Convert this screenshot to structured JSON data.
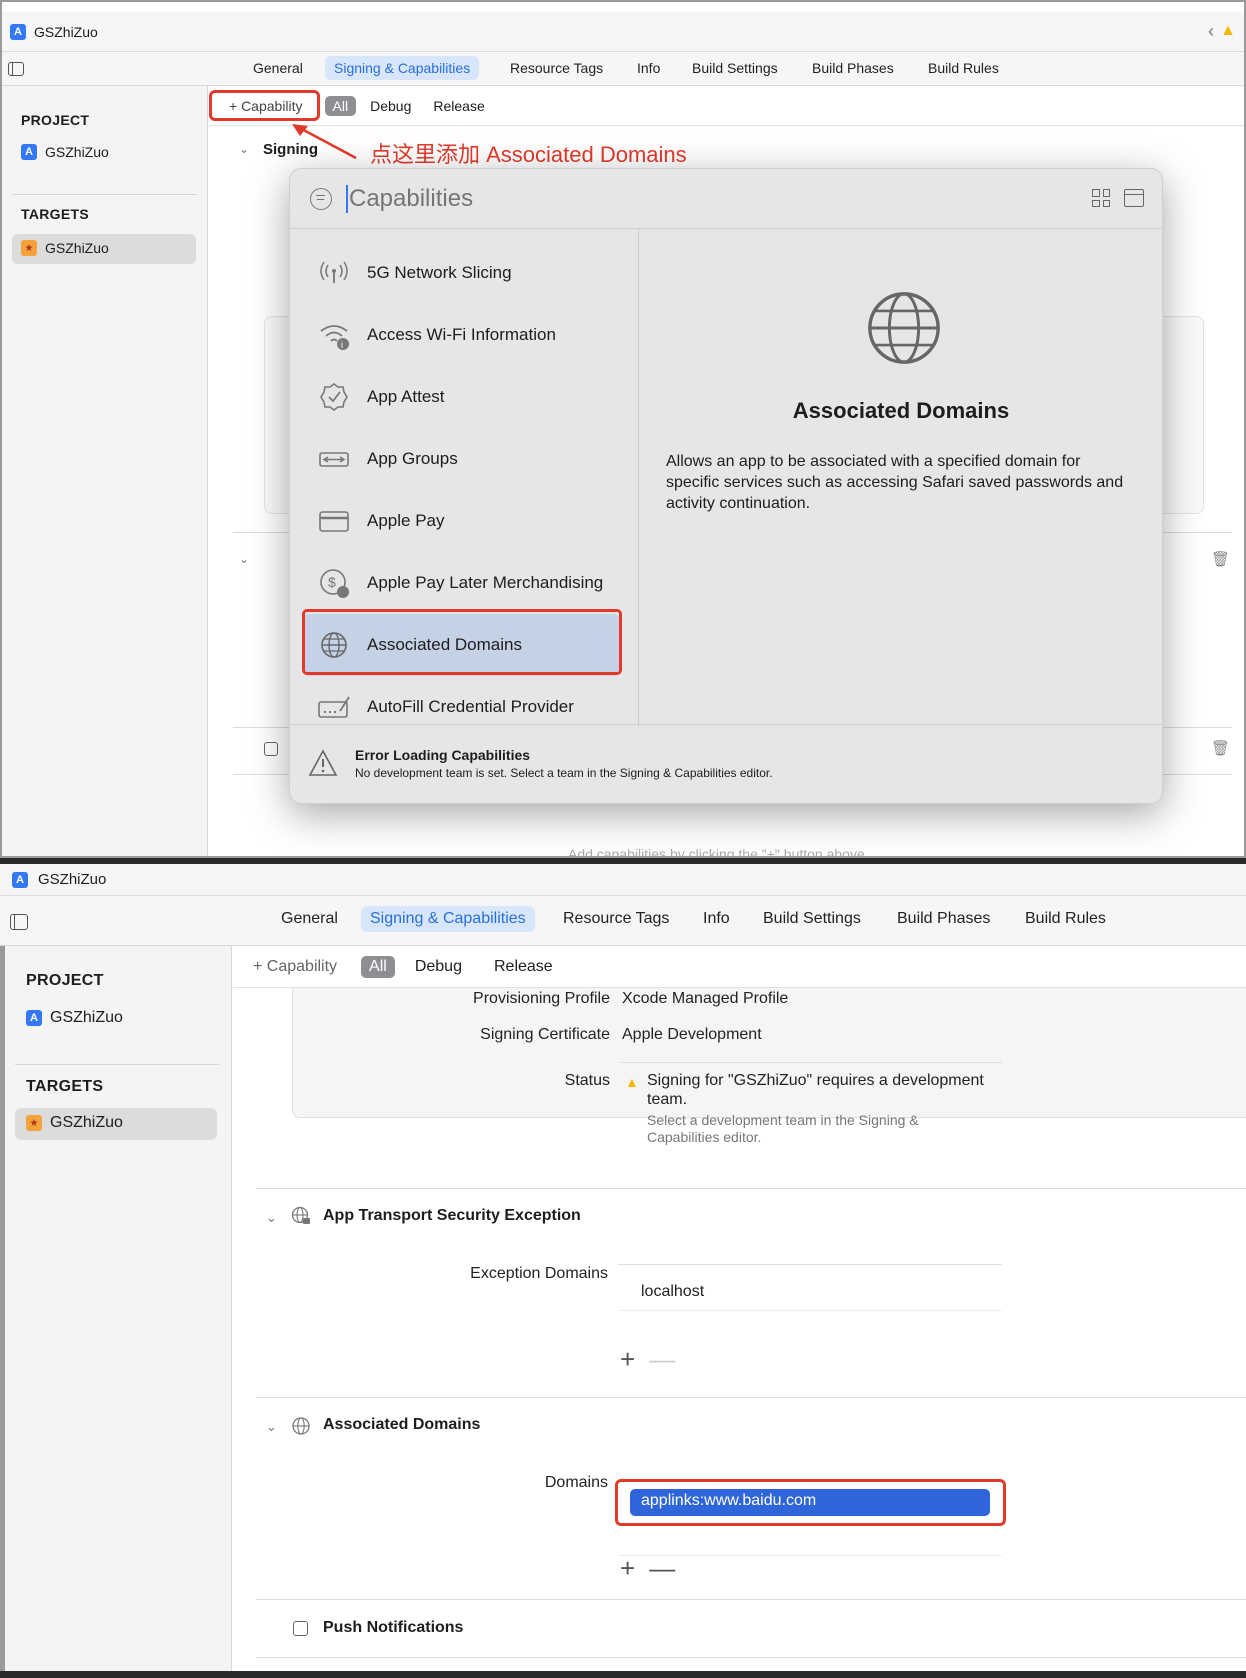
{
  "top": {
    "window_title": "GSZhiZuo",
    "tabs": [
      "General",
      "Signing & Capabilities",
      "Resource Tags",
      "Info",
      "Build Settings",
      "Build Phases",
      "Build Rules"
    ],
    "sidebar": {
      "project_header": "PROJECT",
      "project_item": "GSZhiZuo",
      "targets_header": "TARGETS",
      "target_item": "GSZhiZuo"
    },
    "toolbar": {
      "add_capability": "+ Capability",
      "filters": [
        "All",
        "Debug",
        "Release"
      ]
    },
    "signing_label": "Signing",
    "annotation": "点这里添加 Associated Domains",
    "popover": {
      "search_placeholder": "Capabilities",
      "items": [
        {
          "label": "5G Network Slicing",
          "icon": "antenna-icon"
        },
        {
          "label": "Access Wi-Fi Information",
          "icon": "wifi-info-icon"
        },
        {
          "label": "App Attest",
          "icon": "seal-check-icon"
        },
        {
          "label": "App Groups",
          "icon": "app-groups-icon"
        },
        {
          "label": "Apple Pay",
          "icon": "credit-card-icon"
        },
        {
          "label": "Apple Pay Later Merchandising",
          "icon": "dollar-clock-icon"
        },
        {
          "label": "Associated Domains",
          "icon": "globe-icon"
        },
        {
          "label": "AutoFill Credential Provider",
          "icon": "keyboard-icon"
        }
      ],
      "detail_title": "Associated Domains",
      "detail_text": "Allows an app to be associated with a specified domain for specific services such as accessing Safari saved passwords and activity continuation.",
      "footer_title": "Error Loading Capabilities",
      "footer_text": "No development team is set. Select a team in the Signing & Capabilities editor."
    },
    "hint": "Add capabilities by clicking the \"+\" button above."
  },
  "bottom": {
    "window_title": "GSZhiZuo",
    "tabs": [
      "General",
      "Signing & Capabilities",
      "Resource Tags",
      "Info",
      "Build Settings",
      "Build Phases",
      "Build Rules"
    ],
    "sidebar": {
      "project_header": "PROJECT",
      "project_item": "GSZhiZuo",
      "targets_header": "TARGETS",
      "target_item": "GSZhiZuo"
    },
    "toolbar": {
      "add_capability": "+ Capability",
      "filters": [
        "All",
        "Debug",
        "Release"
      ]
    },
    "signing": {
      "provisioning_label": "Provisioning Profile",
      "provisioning_value": "Xcode Managed Profile",
      "certificate_label": "Signing Certificate",
      "certificate_value": "Apple Development",
      "status_label": "Status",
      "status_line1": "Signing for \"GSZhiZuo\" requires a development",
      "status_line2": "team.",
      "status_sub1": "Select a development team in the Signing &",
      "status_sub2": "Capabilities editor."
    },
    "ats": {
      "title": "App Transport Security Exception",
      "label": "Exception Domains",
      "value": "localhost"
    },
    "assoc": {
      "title": "Associated Domains",
      "label": "Domains",
      "value": "applinks:www.baidu.com"
    },
    "push_title": "Push Notifications"
  },
  "colors": {
    "accent": "#2a6fd8",
    "selection": "#2e66d9",
    "annotation_red": "#e23a2a",
    "warning": "#f5b800"
  }
}
